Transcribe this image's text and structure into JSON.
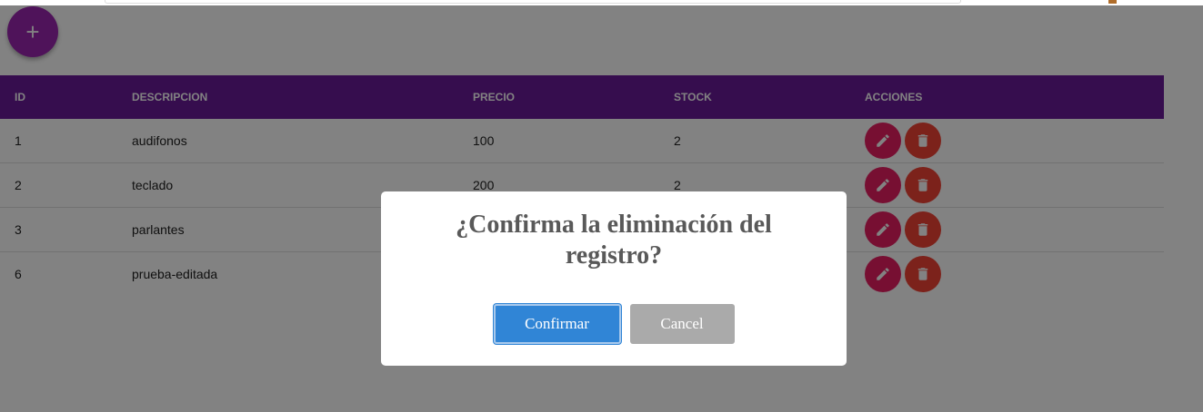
{
  "fab": {
    "label": "+"
  },
  "table": {
    "headers": {
      "id": "ID",
      "descripcion": "DESCRIPCION",
      "precio": "PRECIO",
      "stock": "STOCK",
      "acciones": "ACCIONES"
    },
    "rows": [
      {
        "id": "1",
        "descripcion": "audifonos",
        "precio": "100",
        "stock": "2"
      },
      {
        "id": "2",
        "descripcion": "teclado",
        "precio": "200",
        "stock": "2"
      },
      {
        "id": "3",
        "descripcion": "parlantes",
        "precio": "",
        "stock": ""
      },
      {
        "id": "6",
        "descripcion": "prueba-editada",
        "precio": "",
        "stock": ""
      }
    ],
    "actions": {
      "edit_icon": "pencil-icon",
      "delete_icon": "trash-icon"
    }
  },
  "dialog": {
    "title": "¿Confirma la eliminación del registro?",
    "confirm_label": "Confirmar",
    "cancel_label": "Cancel"
  },
  "colors": {
    "header": "#6a1b9a",
    "fab": "#9c27b0",
    "edit": "#e91e63",
    "delete": "#f44336",
    "confirm": "#3085d6",
    "cancel": "#aaaaaa"
  }
}
